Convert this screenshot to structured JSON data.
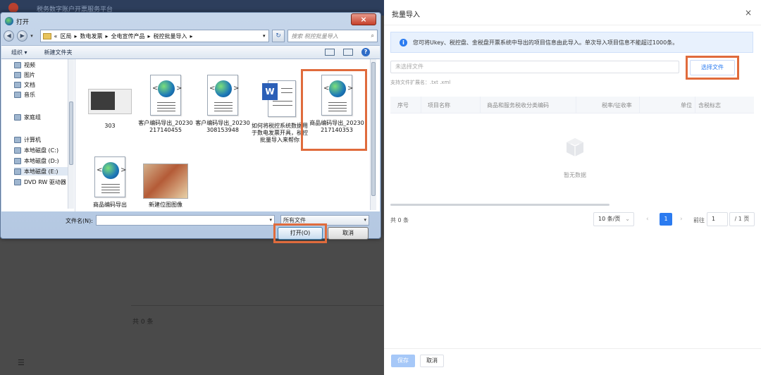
{
  "background": {
    "title": "税务数字账户开票服务平台",
    "count_text": "共 0 条",
    "menu_icon": "☰"
  },
  "dialog": {
    "title": "打开",
    "breadcrumb": [
      "«",
      "区局",
      "数电发票",
      "全电宣传产品",
      "税控批量导入"
    ],
    "search_placeholder": "搜索 税控批量导入",
    "toolbar": {
      "organize": "组织 ▾",
      "new_folder": "新建文件夹"
    },
    "nav_items": [
      {
        "label": "视频",
        "icon": "video-icon"
      },
      {
        "label": "图片",
        "icon": "picture-icon"
      },
      {
        "label": "文档",
        "icon": "document-icon"
      },
      {
        "label": "音乐",
        "icon": "music-icon"
      },
      {
        "label": "家庭组",
        "icon": "homegroup-icon"
      },
      {
        "label": "计算机",
        "icon": "computer-icon"
      },
      {
        "label": "本地磁盘 (C:)",
        "icon": "drive-icon"
      },
      {
        "label": "本地磁盘 (D:)",
        "icon": "drive-icon"
      },
      {
        "label": "本地磁盘 (E:)",
        "icon": "drive-icon"
      },
      {
        "label": "DVD RW 驱动器",
        "icon": "dvd-icon"
      }
    ],
    "files": [
      {
        "name": "303"
      },
      {
        "name": "客户编码导出_20230217140455"
      },
      {
        "name": "客户编码导出_20230308153948"
      },
      {
        "name": "如何将税控系统数据用于数电发票开具，税控批量导入来帮你"
      },
      {
        "name": "商品编码导出_20230217140353"
      },
      {
        "name": "商品编码导出"
      },
      {
        "name": "新建位图图像"
      }
    ],
    "filename_label": "文件名(N):",
    "filename_value": "",
    "filetype": "所有文件",
    "open_label": "打开(O)",
    "cancel_label": "取消"
  },
  "panel": {
    "title": "批量导入",
    "close": "×",
    "info": "您可将Ukey、税控盘、金税盘开票系统中导出的项目信息由此导入。单次导入项目信息不能超过1000条。",
    "file_placeholder": "未选择文件",
    "choose_file": "选择文件",
    "ext_hint": "支持文件扩展名：.txt .xml",
    "columns": [
      "序号",
      "项目名称",
      "商品和服务税收分类编码",
      "税率/征收率",
      "单位",
      "含税标志"
    ],
    "empty_text": "暂无数据",
    "pager": {
      "total": "共 0 条",
      "page_size": "10 条/页",
      "current_page": "1",
      "goto_label": "前往",
      "goto_value": "1",
      "total_pages": "/ 1 页"
    },
    "save_label": "保存",
    "cancel_label": "取消"
  },
  "colors": {
    "accent": "#2b7bf0",
    "highlight": "#e06b3c"
  }
}
